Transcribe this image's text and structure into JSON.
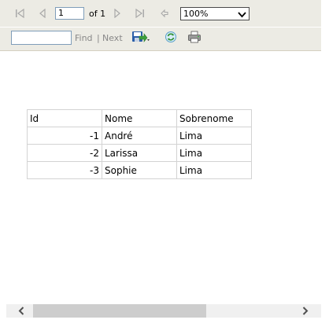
{
  "toolbar": {
    "page_number": "1",
    "page_total_label": "of 1",
    "zoom": "100%",
    "zoom_options": [
      "100%"
    ],
    "find_placeholder": "",
    "find_label": "Find",
    "separator": "|",
    "next_label": "Next"
  },
  "icons": {
    "first": "first-page-icon",
    "prev": "previous-page-icon",
    "next": "next-page-icon",
    "last": "last-page-icon",
    "back": "back-to-parent-icon",
    "export": "export-icon",
    "refresh": "refresh-icon",
    "print": "print-icon"
  },
  "report": {
    "headers": [
      "Id",
      "Nome",
      "Sobrenome"
    ],
    "rows": [
      {
        "id": "-1",
        "nome": "André",
        "sobrenome": "Lima"
      },
      {
        "id": "-2",
        "nome": "Larissa",
        "sobrenome": "Lima"
      },
      {
        "id": "-3",
        "nome": "Sophie",
        "sobrenome": "Lima"
      }
    ]
  },
  "colors": {
    "toolbar_bg": "#ecebe4",
    "disabled_text": "#888888",
    "table_border": "#d3d3d3",
    "scroll_track": "#f0f0f0",
    "scroll_thumb": "#cdcdcd"
  }
}
